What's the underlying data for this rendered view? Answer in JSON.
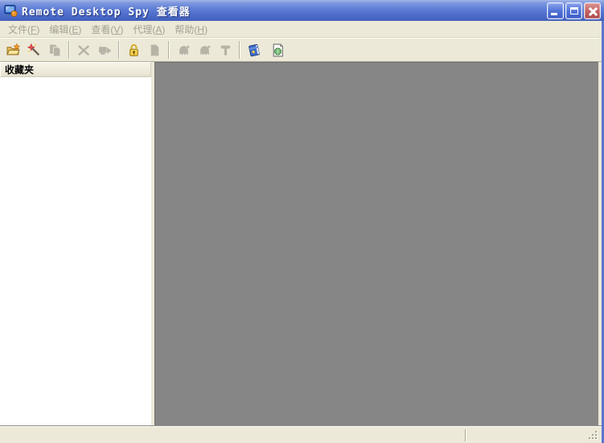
{
  "window": {
    "title": "Remote Desktop Spy 查看器",
    "icon": "remote-desktop-icon",
    "controls": [
      {
        "name": "minimize"
      },
      {
        "name": "maximize"
      },
      {
        "name": "close"
      }
    ]
  },
  "menu": {
    "items": [
      {
        "pre": "文件(",
        "key": "F",
        "post": ")"
      },
      {
        "pre": "编辑(",
        "key": "E",
        "post": ")"
      },
      {
        "pre": "查看(",
        "key": "V",
        "post": ")"
      },
      {
        "pre": "代理(",
        "key": "A",
        "post": ")"
      },
      {
        "pre": "帮助(",
        "key": "H",
        "post": ")"
      }
    ]
  },
  "toolbar": {
    "buttons": [
      {
        "name": "open",
        "icon": "open-folder-new-icon",
        "enabled": true
      },
      {
        "name": "wizard",
        "icon": "magic-wand-icon",
        "enabled": true
      },
      {
        "name": "copy",
        "icon": "copy-documents-icon",
        "enabled": false
      },
      {
        "name": "delete",
        "icon": "delete-x-icon",
        "enabled": false
      },
      {
        "name": "export",
        "icon": "monitor-arrow-icon",
        "enabled": false
      },
      {
        "name": "lock",
        "icon": "padlock-icon",
        "enabled": true
      },
      {
        "name": "log",
        "icon": "document-icon",
        "enabled": false
      },
      {
        "name": "play",
        "icon": "ghost-icon",
        "enabled": false
      },
      {
        "name": "play-all",
        "icon": "ghost-icon",
        "enabled": false
      },
      {
        "name": "tools",
        "icon": "hammer-icon",
        "enabled": false
      },
      {
        "name": "help",
        "icon": "help-book-icon",
        "enabled": true
      },
      {
        "name": "website",
        "icon": "web-document-icon",
        "enabled": true
      }
    ]
  },
  "sidebar": {
    "header": "收藏夹"
  },
  "statusbar": {
    "left_text": "",
    "right_text": ""
  },
  "colors": {
    "titlebar_top": "#a3b6e8",
    "titlebar_bottom": "#4160ba",
    "chrome": "#ece9d8",
    "workspace_gray": "#868686",
    "window_border_blue": "#5b76cc",
    "menu_text_gray": "#a5a295",
    "disabled_icon_gray": "#b7b3a6"
  }
}
